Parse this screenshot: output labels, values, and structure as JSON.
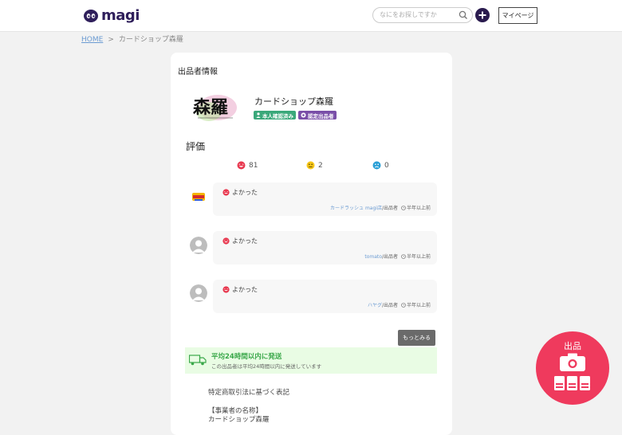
{
  "header": {
    "logo_text": "magi",
    "search_placeholder": "なにをお探しですか",
    "mypage_label": "マイページ"
  },
  "breadcrumb": {
    "home": "HOME",
    "separator": ">",
    "current": "カードショップ森羅"
  },
  "seller": {
    "section_title": "出品者情報",
    "logo_text": "森羅",
    "name": "カードショップ森羅",
    "badge_verified": "本人確認済み",
    "badge_certified": "認定出品者"
  },
  "rating": {
    "title": "評価",
    "good": "81",
    "normal": "2",
    "bad": "0"
  },
  "reviews": [
    {
      "text": "よかった",
      "user": "カードラッシュ magi店",
      "role": "/出品者",
      "time": "半年以上前"
    },
    {
      "text": "よかった",
      "user": "tomato",
      "role": "/出品者",
      "time": "半年以上前"
    },
    {
      "text": "よかった",
      "user": "ハヤグ",
      "role": "/出品者",
      "time": "半年以上前"
    }
  ],
  "more_label": "もっとみる",
  "shipping": {
    "title": "平均24時間以内に発送",
    "subtitle": "この出品者は平均24時間以内に発送しています"
  },
  "law": {
    "heading": "特定商取引法に基づく表記",
    "business_label": "【事業者の名称】",
    "business_name": "カードショップ森羅"
  },
  "sell_button_label": "出品",
  "colors": {
    "accent_purple": "#2a1b4e",
    "good_red": "#e8384f",
    "normal_yellow": "#f5c518",
    "bad_blue": "#2a9fd6",
    "badge_green": "#3aa87a",
    "badge_purple": "#7a4fa8",
    "ship_green": "#3aa84a",
    "sell_red": "#ef3a5d"
  }
}
